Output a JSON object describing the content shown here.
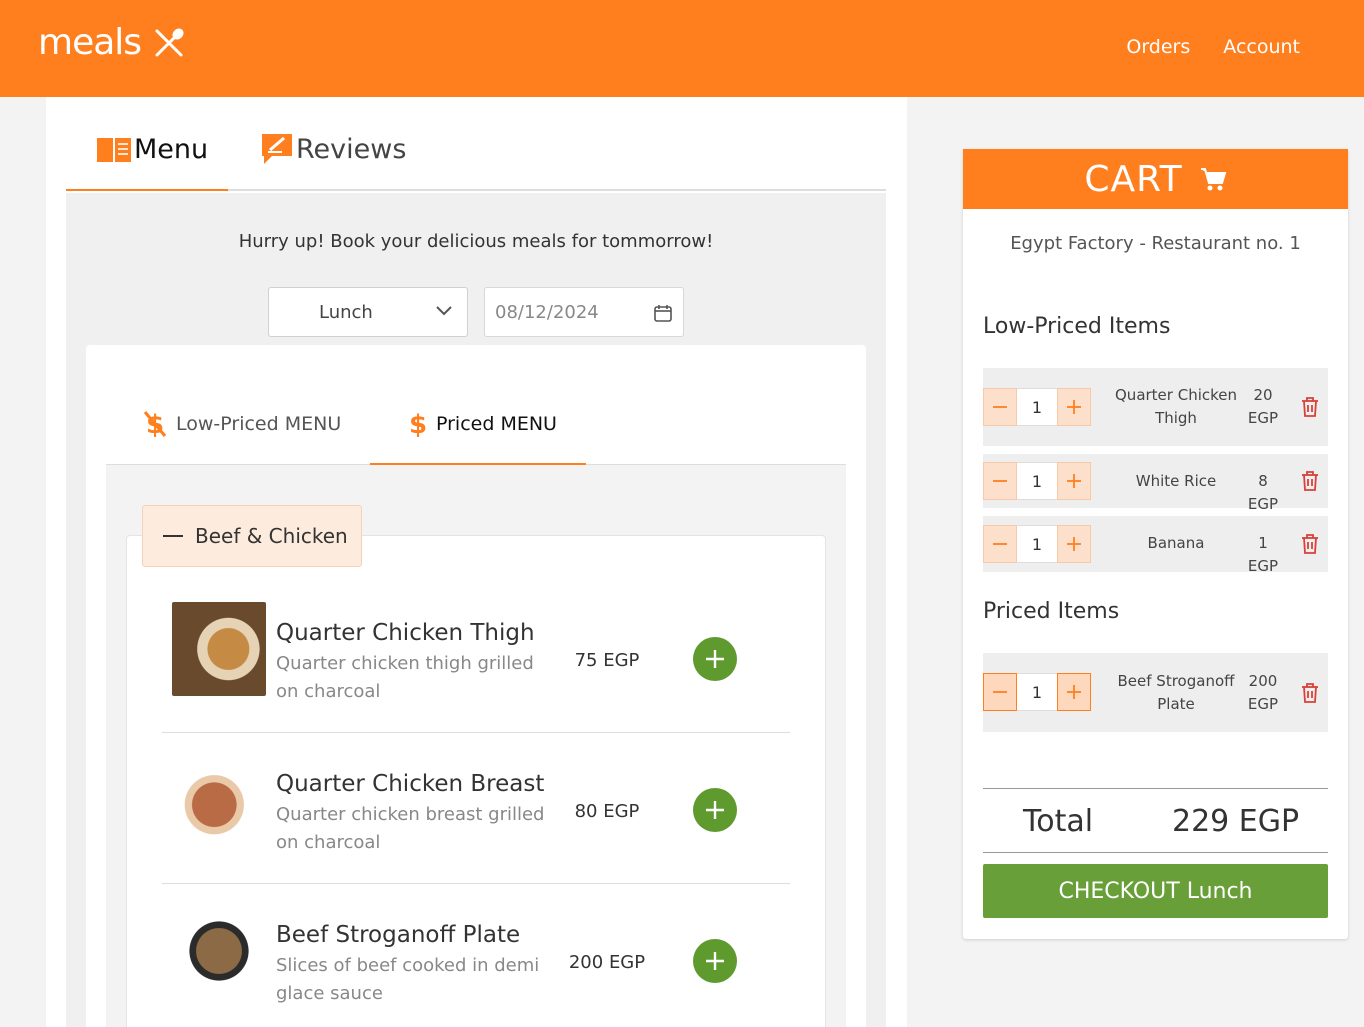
{
  "header": {
    "logo": "meals",
    "nav": [
      "Orders",
      "Account"
    ]
  },
  "tabs": {
    "menu": "Menu",
    "reviews": "Reviews"
  },
  "booking": {
    "message": "Hurry up! Book your delicious meals for tommorrow!",
    "meal_type": "Lunch",
    "date": "08/12/2024"
  },
  "sub_tabs": {
    "low": "Low-Priced MENU",
    "priced": "Priced MENU"
  },
  "category": "Beef & Chicken",
  "items": [
    {
      "name": "Quarter Chicken Thigh",
      "desc": "Quarter chicken thigh grilled on charcoal",
      "price": "75 EGP"
    },
    {
      "name": "Quarter Chicken Breast",
      "desc": "Quarter chicken breast grilled on charcoal",
      "price": "80 EGP"
    },
    {
      "name": "Beef Stroganoff Plate",
      "desc": "Slices of beef cooked in demi glace sauce",
      "price": "200 EGP"
    }
  ],
  "cart": {
    "title": "CART",
    "restaurant": "Egypt Factory - Restaurant no. 1",
    "low_title": "Low-Priced Items",
    "low_items": [
      {
        "qty": "1",
        "name": "Quarter Chicken Thigh",
        "price": "20 EGP"
      },
      {
        "qty": "1",
        "name": "White Rice",
        "price": "8 EGP"
      },
      {
        "qty": "1",
        "name": "Banana",
        "price": "1 EGP"
      }
    ],
    "priced_title": "Priced Items",
    "priced_items": [
      {
        "qty": "1",
        "name": "Beef Stroganoff Plate",
        "price": "200 EGP"
      }
    ],
    "total_label": "Total",
    "total_value": "229 EGP",
    "checkout": "CHECKOUT Lunch"
  },
  "colors": {
    "brand": "#ff7f1e",
    "add_button": "#5f9a2e",
    "checkout": "#689f38",
    "trash": "#d9403a"
  }
}
